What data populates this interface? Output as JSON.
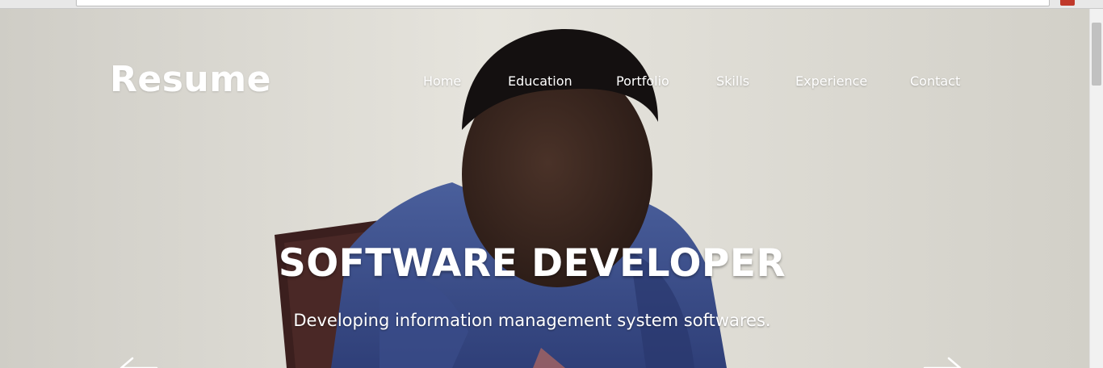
{
  "site": {
    "brand": "Resume"
  },
  "nav": {
    "items": [
      {
        "label": "Home"
      },
      {
        "label": "Education"
      },
      {
        "label": "Portfolio"
      },
      {
        "label": "Skills"
      },
      {
        "label": "Experience"
      },
      {
        "label": "Contact"
      }
    ]
  },
  "hero": {
    "headline": "SOFTWARE DEVELOPER",
    "tagline": "Developing information management system softwares."
  },
  "icons": {
    "prev": "arrow-left-icon",
    "next": "arrow-right-icon"
  },
  "colors": {
    "text": "#ffffff",
    "jacket": "#3c4f8c"
  }
}
